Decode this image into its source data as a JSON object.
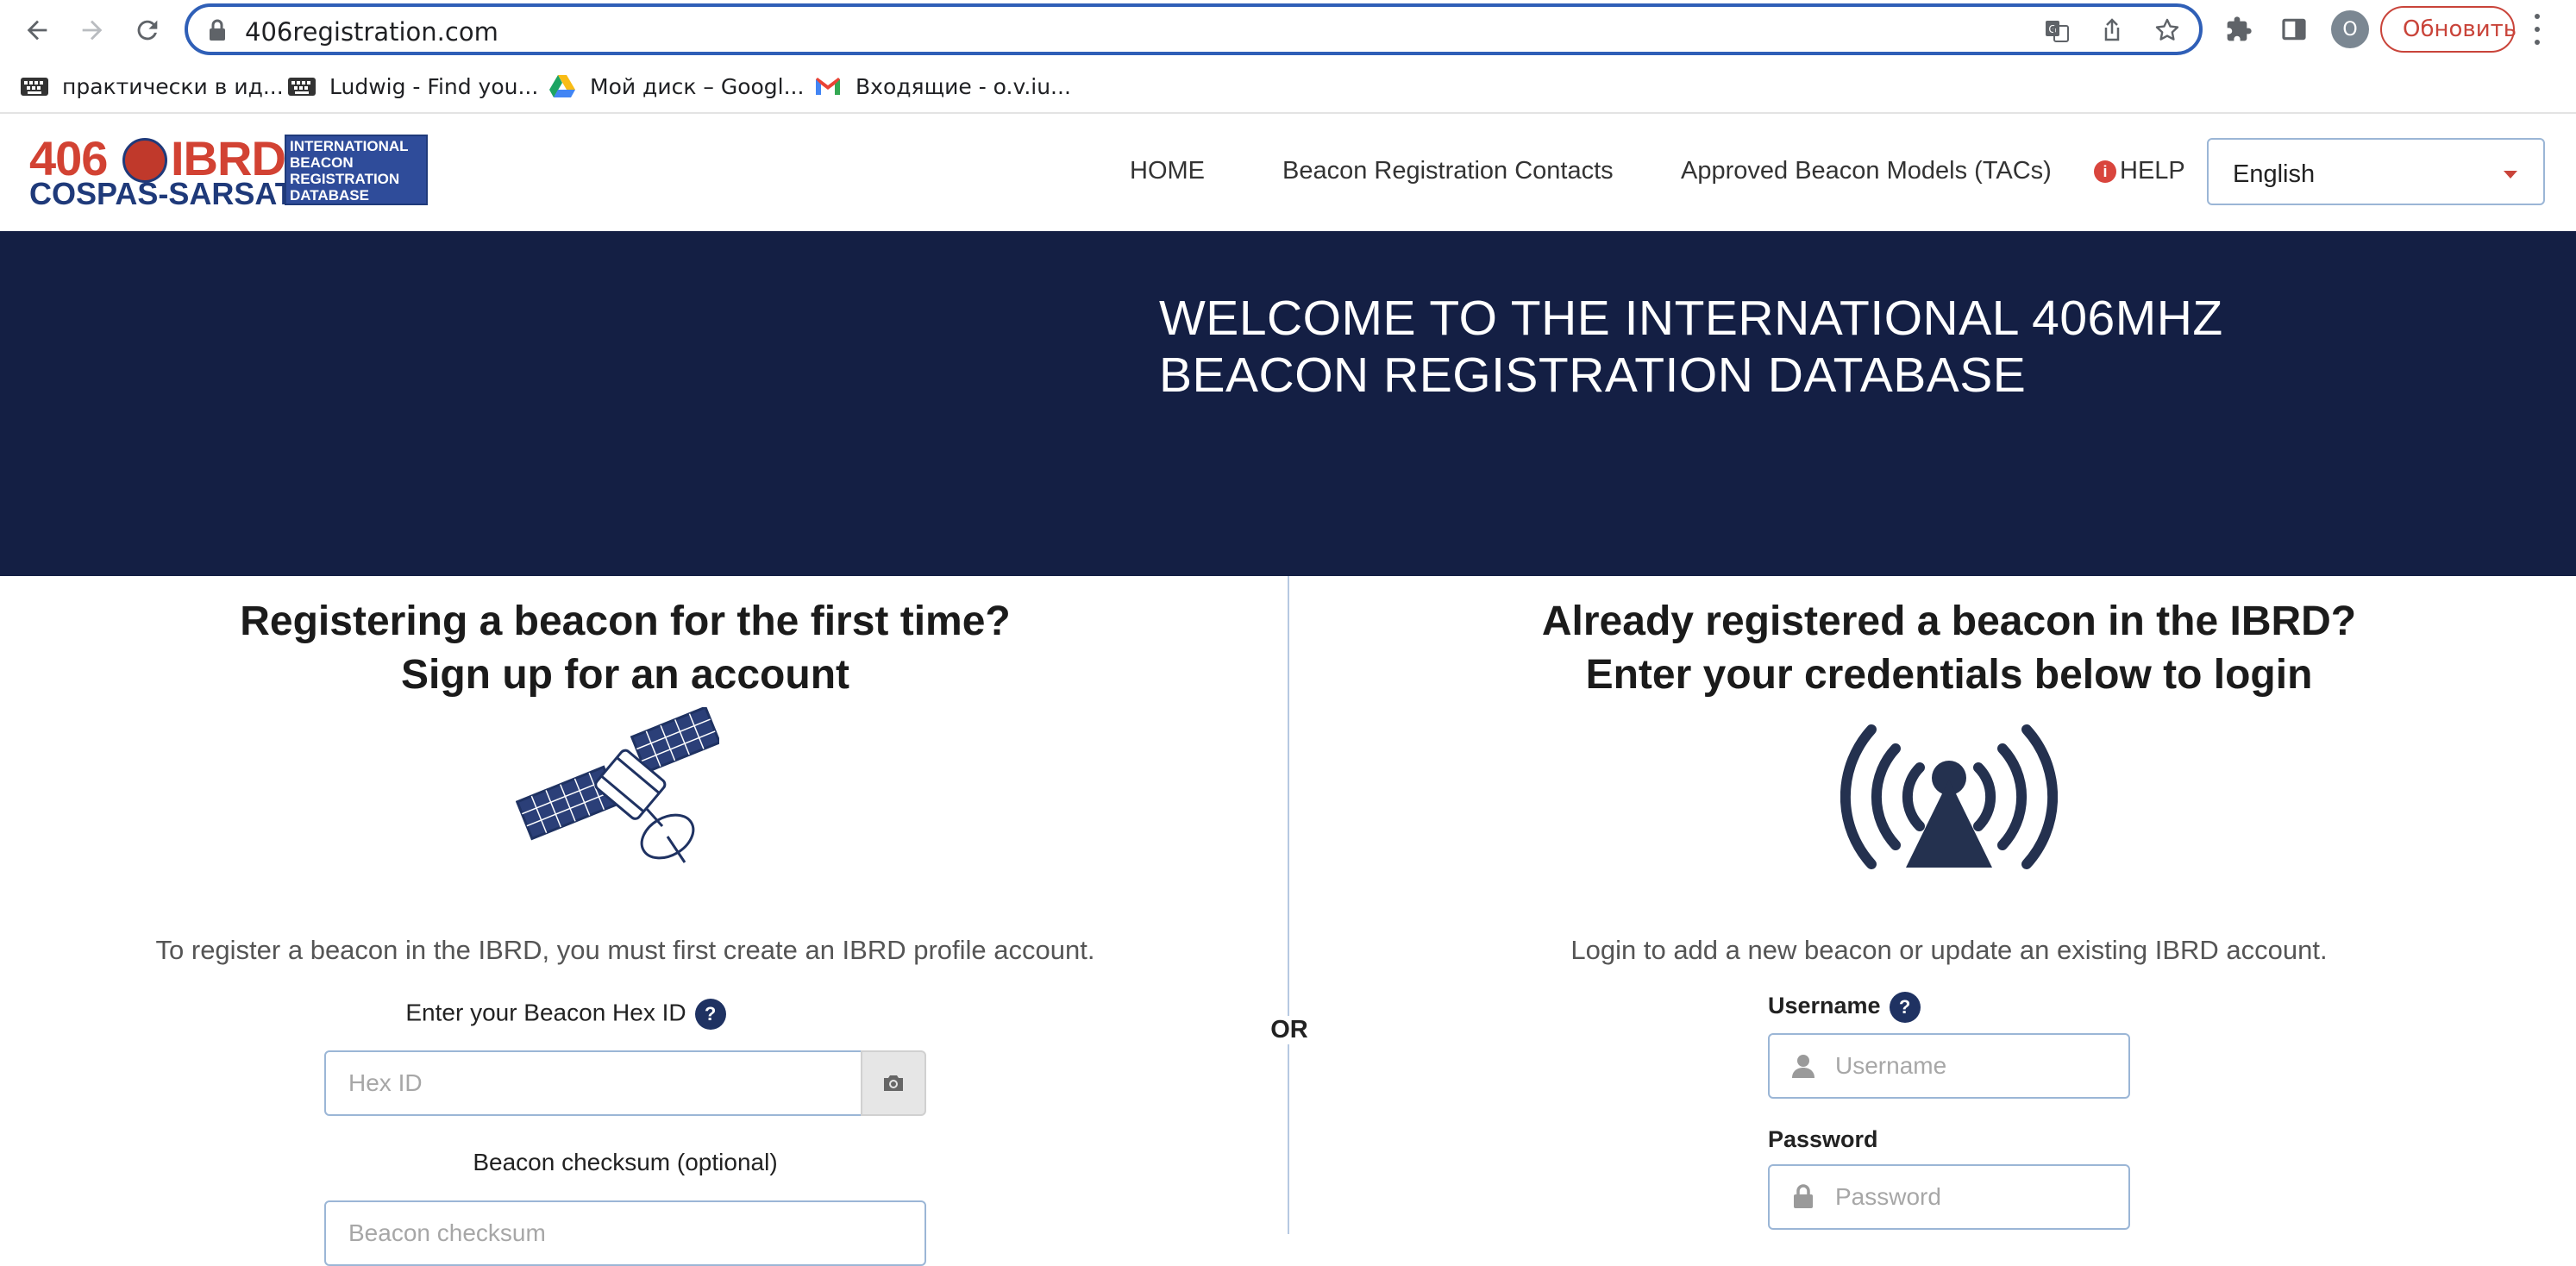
{
  "browser": {
    "url": "406registration.com",
    "update_label": "Обновить",
    "profile_initial": "O",
    "bookmarks": [
      {
        "label": "практически в ид...",
        "icon": "keyboard-icon"
      },
      {
        "label": "Ludwig - Find you...",
        "icon": "keyboard-icon"
      },
      {
        "label": "Мой диск – Googl...",
        "icon": "google-drive-icon"
      },
      {
        "label": "Входящие - o.v.iu...",
        "icon": "gmail-icon"
      }
    ]
  },
  "header": {
    "logo": {
      "line1": "406",
      "line1b": "IBRD",
      "line2": "COSPAS-SARSAT",
      "box_lines": [
        "INTERNATIONAL",
        "BEACON",
        "REGISTRATION",
        "DATABASE"
      ]
    },
    "nav": {
      "home": "HOME",
      "contacts": "Beacon Registration Contacts",
      "models": "Approved Beacon Models (TACs)",
      "help": "HELP"
    },
    "language": "English"
  },
  "hero": {
    "title_line1": "WELCOME TO THE INTERNATIONAL 406MHZ",
    "title_line2": "BEACON REGISTRATION DATABASE"
  },
  "signup": {
    "title_line1": "Registering a beacon for the first time?",
    "title_line2": "Sign up for an account",
    "lead": "To register a beacon in the IBRD, you must first create an IBRD profile account.",
    "hex_label": "Enter your Beacon Hex ID",
    "hex_placeholder": "Hex ID",
    "checksum_label": "Beacon checksum (optional)",
    "checksum_placeholder": "Beacon checksum"
  },
  "or_label": "OR",
  "login": {
    "title_line1": "Already registered a beacon in the IBRD?",
    "title_line2": "Enter your credentials below to login",
    "lead": "Login to add a new beacon or update an existing IBRD account.",
    "username_label": "Username",
    "username_placeholder": "Username",
    "password_label": "Password",
    "password_placeholder": "Password"
  },
  "help_badge": "?",
  "colors": {
    "hero_bg": "#141f44",
    "brand_red": "#d24233",
    "brand_blue": "#1f3a7a",
    "input_border": "#9bb6d6"
  }
}
